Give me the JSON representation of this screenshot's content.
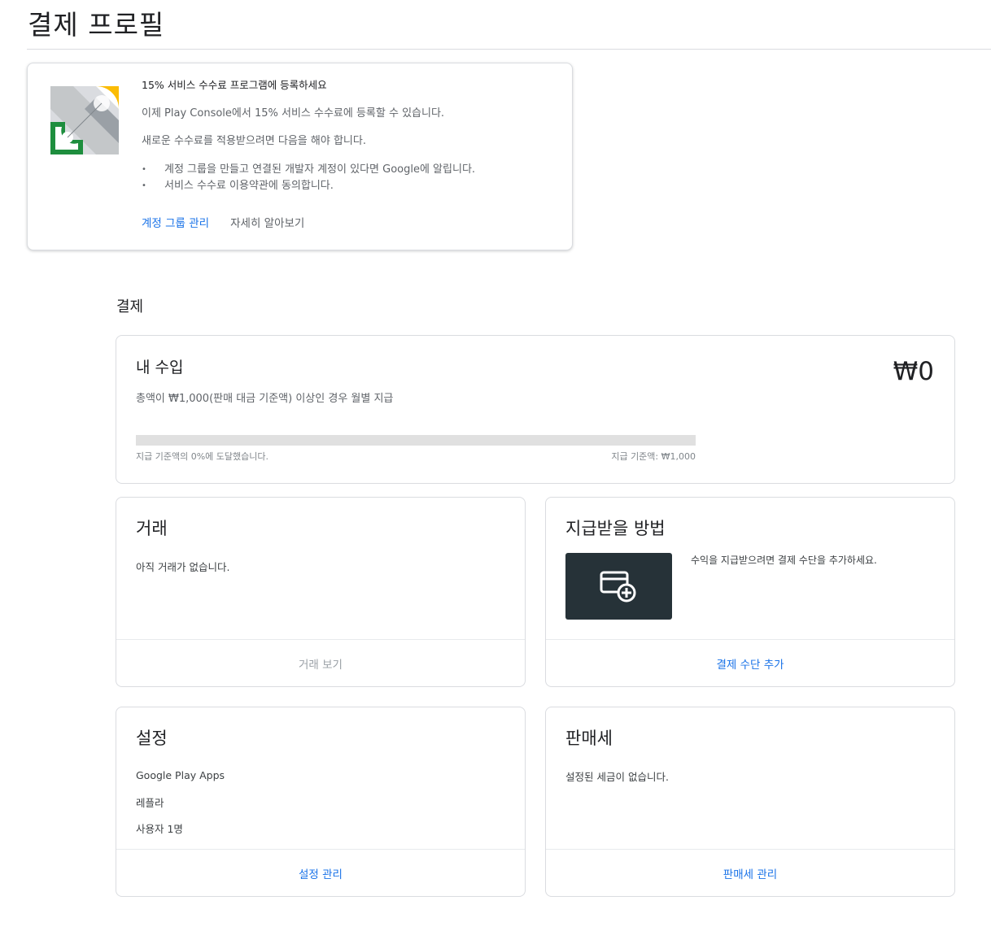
{
  "page": {
    "title": "결제 프로필"
  },
  "promo": {
    "title": "15% 서비스 수수료 프로그램에 등록하세요",
    "text1": "이제 Play Console에서 15% 서비스 수수료에 등록할 수 있습니다.",
    "text2": "새로운 수수료를 적용받으려면 다음을 해야 합니다.",
    "bullets": [
      "계정 그룹을 만들고 연결된 개발자 계정이 있다면 Google에 알립니다.",
      "서비스 수수료 이용약관에 동의합니다."
    ],
    "link_manage": "계정 그룹 관리",
    "link_learn": "자세히 알아보기"
  },
  "payments": {
    "heading": "결제",
    "earnings": {
      "title": "내 수입",
      "amount": "₩0",
      "description": "총액이 ₩1,000(판매 대금 기준액) 이상인 경우 월별 지급",
      "progress_percent": 0,
      "progress_label": "지급 기준액의 0%에 도달했습니다.",
      "threshold_label": "지급 기준액: ₩1,000"
    },
    "transactions": {
      "title": "거래",
      "empty_text": "아직 거래가 없습니다.",
      "footer": "거래 보기"
    },
    "payout_method": {
      "title": "지급받을 방법",
      "description": "수익을 지급받으려면 결제 수단을 추가하세요.",
      "footer": "결제 수단 추가"
    },
    "settings": {
      "title": "설정",
      "account_name": "Google Play Apps",
      "profile_name": "레플라",
      "users_link": "사용자 1명",
      "footer": "설정 관리"
    },
    "sales_tax": {
      "title": "판매세",
      "empty_text": "설정된 세금이 없습니다.",
      "footer": "판매세 관리"
    }
  },
  "colors": {
    "accent": "#1a73e8",
    "yellow": "#fbbc04",
    "green": "#1e8e3e",
    "dark_box": "#263238"
  },
  "icons": {
    "promo": "fee-program-illustration",
    "payment": "add-card-icon"
  }
}
